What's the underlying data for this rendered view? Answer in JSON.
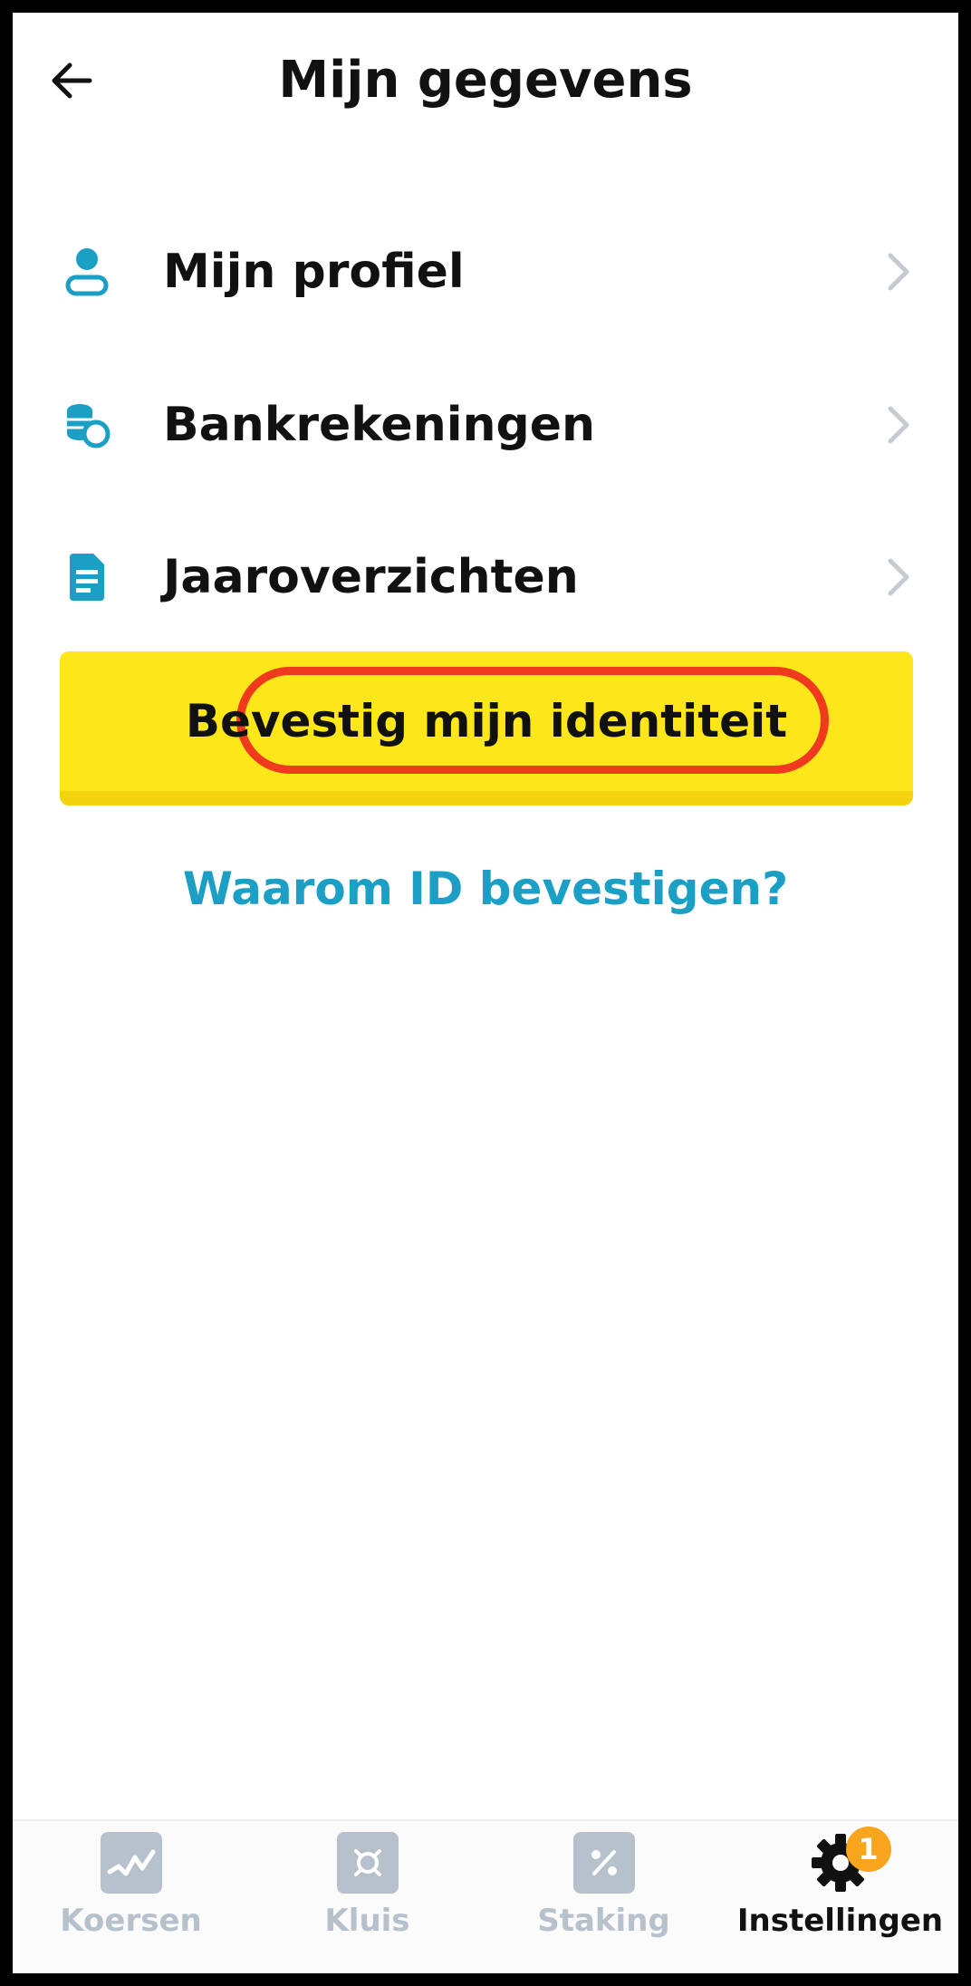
{
  "header": {
    "title": "Mijn gegevens",
    "back_icon": "arrow-left-icon"
  },
  "menu": {
    "items": [
      {
        "label": "Mijn profiel",
        "icon": "user-icon"
      },
      {
        "label": "Bankrekeningen",
        "icon": "coins-icon"
      },
      {
        "label": "Jaaroverzichten",
        "icon": "document-icon"
      }
    ]
  },
  "cta": {
    "label": "Bevestig mijn identiteit"
  },
  "links": {
    "why_id": "Waarom ID bevestigen?"
  },
  "bottom_nav": {
    "items": [
      {
        "label": "Koersen",
        "icon": "chart-icon",
        "active": false
      },
      {
        "label": "Kluis",
        "icon": "vault-icon",
        "active": false
      },
      {
        "label": "Staking",
        "icon": "percent-icon",
        "active": false
      },
      {
        "label": "Instellingen",
        "icon": "gear-icon",
        "active": true,
        "badge": "1"
      }
    ]
  },
  "colors": {
    "accent": "#1b9fc4",
    "cta_background": "#fde71a",
    "highlight_ring": "#ef3a1e",
    "badge": "#f7a51c",
    "inactive_nav": "#b7c1cc"
  }
}
